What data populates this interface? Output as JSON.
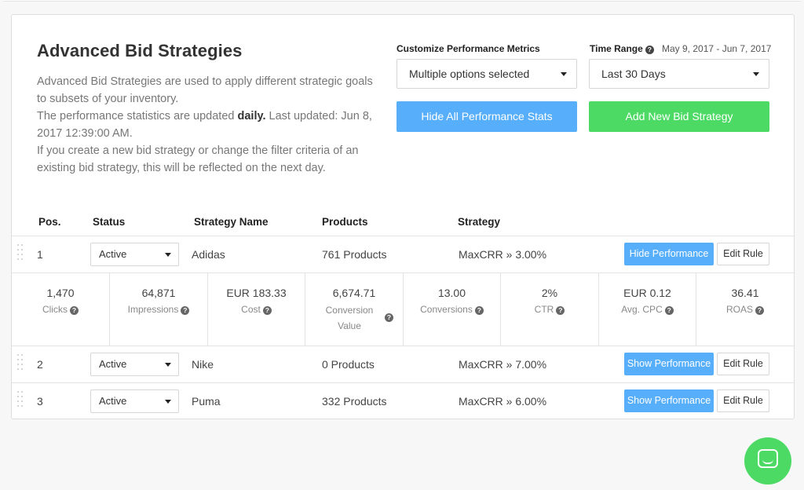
{
  "header": {
    "title": "Advanced Bid Strategies",
    "desc_line1": "Advanced Bid Strategies are used to apply different strategic goals to subsets of your inventory.",
    "desc_line2_prefix": "The performance statistics are updated ",
    "desc_line2_bold": "daily.",
    "desc_line2_suffix": " Last updated: Jun 8, 2017 12:39:00 AM.",
    "desc_line3": "If you create a new bid strategy or change the filter criteria of an existing bid strategy, this will be reflected on the next day."
  },
  "controls": {
    "metrics_label": "Customize Performance Metrics",
    "metrics_value": "Multiple options selected",
    "time_label": "Time Range",
    "date_range": "May 9, 2017 - Jun 7, 2017",
    "time_value": "Last 30 Days",
    "hide_all_label": "Hide All Performance Stats",
    "add_new_label": "Add New Bid Strategy",
    "help_glyph": "?"
  },
  "table": {
    "headers": {
      "pos": "Pos.",
      "status": "Status",
      "name": "Strategy Name",
      "products": "Products",
      "strategy": "Strategy"
    },
    "rows": [
      {
        "pos": "1",
        "status": "Active",
        "name": "Adidas",
        "products": "761 Products",
        "strategy": "MaxCRR » 3.00%",
        "perf_label": "Hide Performance",
        "edit_label": "Edit Rule"
      },
      {
        "pos": "2",
        "status": "Active",
        "name": "Nike",
        "products": "0 Products",
        "strategy": "MaxCRR » 7.00%",
        "perf_label": "Show Performance",
        "edit_label": "Edit Rule"
      },
      {
        "pos": "3",
        "status": "Active",
        "name": "Puma",
        "products": "332 Products",
        "strategy": "MaxCRR » 6.00%",
        "perf_label": "Show Performance",
        "edit_label": "Edit Rule"
      }
    ],
    "stats": [
      {
        "value": "1,470",
        "label": "Clicks"
      },
      {
        "value": "64,871",
        "label": "Impressions"
      },
      {
        "value": "EUR 183.33",
        "label": "Cost"
      },
      {
        "value": "6,674.71",
        "label_line1": "Conversion",
        "label_line2": "Value"
      },
      {
        "value": "13.00",
        "label": "Conversions"
      },
      {
        "value": "2%",
        "label": "CTR"
      },
      {
        "value": "EUR 0.12",
        "label": "Avg. CPC"
      },
      {
        "value": "36.41",
        "label": "ROAS"
      }
    ]
  },
  "colors": {
    "primary_blue": "#57aefb",
    "primary_green": "#4cda65"
  },
  "icons": [
    "help-icon",
    "caret-down-icon",
    "drag-handle-icon",
    "chat-icon"
  ]
}
